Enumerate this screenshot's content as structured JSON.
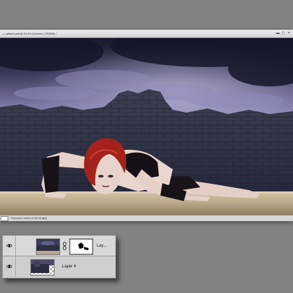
{
  "document": {
    "title": "...r_selec4.psd @ 33,3% (Curves 1, RGB/8) *",
    "controls": {
      "minimize": "▬",
      "maximize": "▢",
      "close": "✕"
    },
    "status": "Exposure works in 32-bit only",
    "status_arrow": "▸"
  },
  "layers": [
    {
      "name": "Lay...",
      "visible": true,
      "has_mask": true,
      "linked": true,
      "selected": true
    },
    {
      "name": "Layer 4",
      "visible": true,
      "has_mask": false,
      "linked": false,
      "selected": false
    }
  ],
  "icons": {
    "visibility": "eye-icon",
    "link": "chain-link-icon"
  },
  "colors": {
    "workspace": "#828282",
    "sky_dark": "#1c1c2e",
    "sky_light": "#8c86b4",
    "hair": "#a8241c",
    "ground": "#cbb99e"
  }
}
